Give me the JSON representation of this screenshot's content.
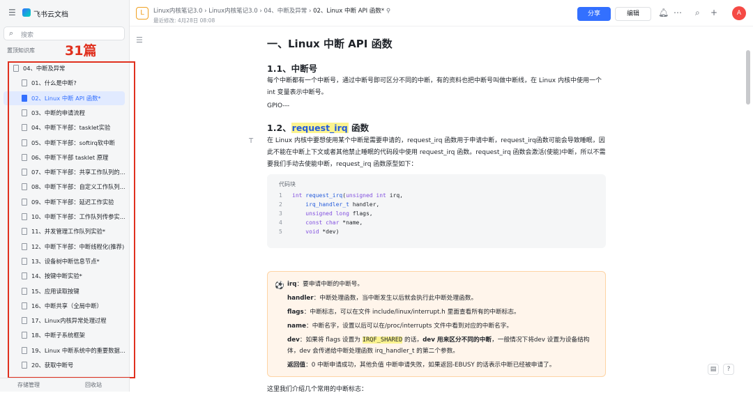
{
  "app": {
    "brand": "飞书云文档"
  },
  "sidebar": {
    "search_placeholder": "搜索",
    "section": "置顶知识库",
    "annotation": "31篇",
    "tree": [
      {
        "label": "04、中断及异常",
        "level": 0,
        "active": false
      },
      {
        "label": "01、什么是中断?",
        "level": 1,
        "active": false
      },
      {
        "label": "02、Linux 中断 API 函数*",
        "level": 1,
        "active": true
      },
      {
        "label": "03、中断的申请流程",
        "level": 1,
        "active": false
      },
      {
        "label": "04、中断下半部：tasklet实验",
        "level": 1,
        "active": false
      },
      {
        "label": "05、中断下半部：softirq软中断",
        "level": 1,
        "active": false
      },
      {
        "label": "06、中断下半部 tasklet 原理",
        "level": 1,
        "active": false
      },
      {
        "label": "07、中断下半部：共享工作队列的...",
        "level": 1,
        "active": false
      },
      {
        "label": "08、中断下半部：自定义工作队列...",
        "level": 1,
        "active": false
      },
      {
        "label": "09、中断下半部：延迟工作实验",
        "level": 1,
        "active": false
      },
      {
        "label": "10、中断下半部：工作队列传参实...",
        "level": 1,
        "active": false
      },
      {
        "label": "11、并发管理工作队列实验*",
        "level": 1,
        "active": false
      },
      {
        "label": "12、中断下半部：中断线程化(推荐)",
        "level": 1,
        "active": false
      },
      {
        "label": "13、设备树中断信息节点*",
        "level": 1,
        "active": false
      },
      {
        "label": "14、按键中断实验*",
        "level": 1,
        "active": false
      },
      {
        "label": "15、应用读取按键",
        "level": 1,
        "active": false
      },
      {
        "label": "16、中断共享（全局中断）",
        "level": 1,
        "active": false
      },
      {
        "label": "17、Linux内核异常处理过程",
        "level": 1,
        "active": false
      },
      {
        "label": "18、中断子系统框架",
        "level": 1,
        "active": false
      },
      {
        "label": "19、Linux 中断系统中的重要数据...",
        "level": 1,
        "active": false
      },
      {
        "label": "20、获取中断号",
        "level": 1,
        "active": false
      }
    ],
    "bottom": {
      "storage": "存储管理",
      "trash": "回收站"
    }
  },
  "header": {
    "doc_icon": "L",
    "breadcrumbs": [
      "Linux内核笔记3.0",
      "Linux内核笔记3.0",
      "04、中断及异常",
      "02、Linux 中断 API 函数*"
    ],
    "modified": "最近修改: 4月28日 08:08",
    "share": "分享",
    "edit": "编辑",
    "avatar": "A"
  },
  "doc": {
    "h1": "一、Linux 中断 API 函数",
    "s1_title": "1.1、中断号",
    "s1_para": "每个中断都有一个中断号，通过中断号即可区分不同的中断，有的资料也把中断号叫做中断线，在 Linux 内核中使用一个 int 变量表示中断号。",
    "s1_gpio": "GPIO---",
    "s2_title_hl": "request_irq",
    "s2_title_rest": " 函数",
    "s2_para": "在 Linux 内核中要想使用某个中断是需要申请的，request_irq 函数用于申请中断，request_irq函数可能会导致睡眠，因此不能在中断上下文或者其他禁止睡眠的代码段中使用 request_irq 函数。request_irq 函数会激活(使能)中断，所以不需要我们手动去使能中断，request_irq 函数原型如下：",
    "code_label": "代码块",
    "code_lines": [
      "int request_irq(unsigned int irq,",
      "    irq_handler_t handler,",
      "    unsigned long flags,",
      "    const char *name,",
      "    void *dev)"
    ],
    "callout": {
      "irq_k": "irq",
      "irq_v": "：要申请中断的中断号。",
      "handler_k": "handler",
      "handler_v": "：中断处理函数，当中断发生以后就会执行此中断处理函数。",
      "flags_k": "flags",
      "flags_v": "：中断标志，可以在文件 include/linux/interrupt.h 里面查看所有的中断标志。",
      "name_k": "name",
      "name_v": "：中断名字，设置以后可以在/proc/interrupts 文件中看到对应的中断名字。",
      "dev_k": "dev",
      "dev_v1": "：如果将 flags 设置为 ",
      "dev_code": "IRQF_SHARED",
      "dev_v2": " 的话，",
      "dev_b": "dev 用来区分不同的中断",
      "dev_v3": "，一般情况下将dev 设置为设备结构体，dev 会传递给中断处理函数 irq_handler_t 的第二个参数。",
      "ret_k": "返回值",
      "ret_v": "：0 中断申请成功，其他负值 中断申请失败，如果返回-EBUSY 的话表示中断已经被申请了。"
    },
    "last_line": "这里我们介绍几个常用的中断标志："
  }
}
